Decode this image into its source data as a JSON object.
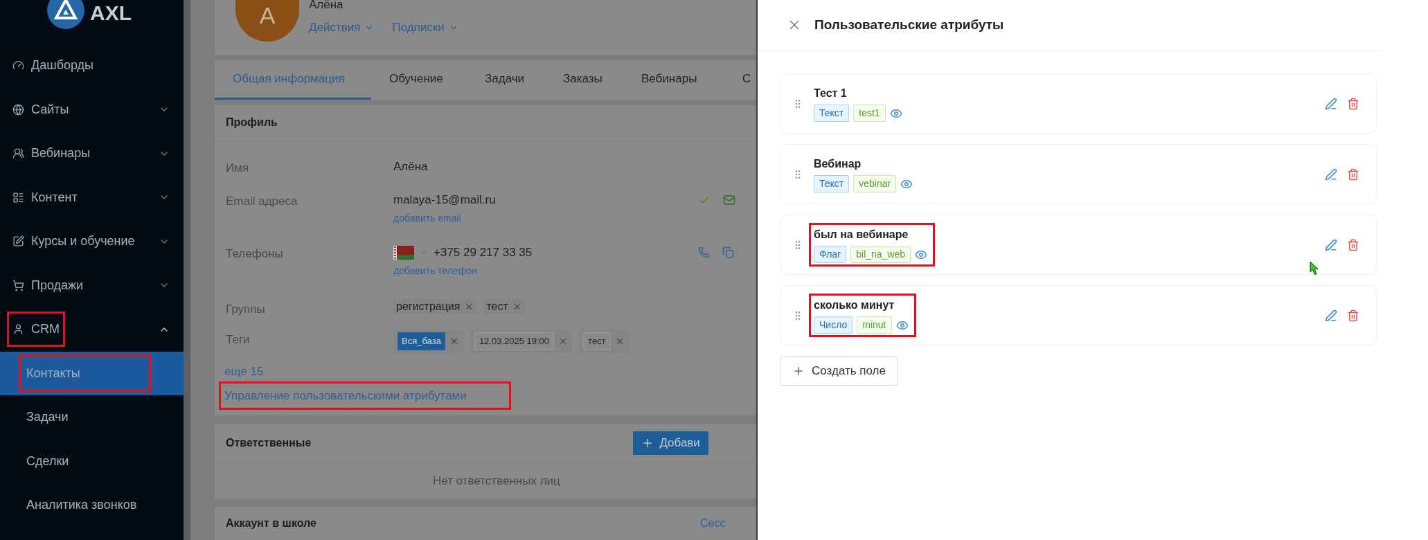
{
  "sidebar": {
    "logo": {
      "text": "AXL"
    },
    "items": [
      {
        "label": "Дашборды",
        "selected": false,
        "annotated": false
      },
      {
        "label": "Сайты",
        "expanded": false,
        "selected": false,
        "annotated": false
      },
      {
        "label": "Вебинары",
        "expanded": false,
        "selected": false,
        "annotated": false
      },
      {
        "label": "Контент",
        "expanded": false,
        "selected": false,
        "annotated": false
      },
      {
        "label": "Курсы и обучение",
        "expanded": false,
        "selected": false,
        "annotated": false
      },
      {
        "label": "Продажи",
        "expanded": false,
        "selected": false,
        "annotated": false
      },
      {
        "label": "CRM",
        "expanded": true,
        "selected": false,
        "annotated": true,
        "children": [
          {
            "label": "Контакты",
            "selected": true,
            "annotated": true
          },
          {
            "label": "Задачи",
            "selected": false,
            "annotated": false
          },
          {
            "label": "Сделки",
            "selected": false,
            "annotated": false
          },
          {
            "label": "Аналитика звонков",
            "selected": false,
            "annotated": false
          }
        ]
      }
    ]
  },
  "contact": {
    "name": "Алёна",
    "avatar_letter": "A",
    "menus": [
      "Действия",
      "Подписки"
    ]
  },
  "tabs": [
    {
      "label": "Общая информация",
      "selected": true
    },
    {
      "label": "Обучение",
      "selected": false
    },
    {
      "label": "Задачи",
      "selected": false
    },
    {
      "label": "Заказы",
      "selected": false
    },
    {
      "label": "Вебинары",
      "selected": false
    },
    {
      "label": "С",
      "selected": false
    }
  ],
  "profile": {
    "title": "Профиль",
    "rows": [
      {
        "kind": "text",
        "label": "Имя",
        "value": "Алёна"
      },
      {
        "kind": "email",
        "label": "Email адреса",
        "value": "malaya-15@mail.ru",
        "add_link": "добавить email"
      },
      {
        "kind": "phone",
        "label": "Телефоны",
        "value": "+375 29 217 33 35",
        "add_link": "добавить телефон"
      },
      {
        "kind": "chips",
        "label": "Группы",
        "chips": [
          {
            "text": "регистрация",
            "highlighted": false
          },
          {
            "text": "тест",
            "highlighted": false
          }
        ]
      },
      {
        "kind": "tags",
        "label": "Теги",
        "chips": [
          {
            "text": "Вся_база",
            "highlighted": true
          },
          {
            "text": "12.03.2025 19:00",
            "highlighted": false
          },
          {
            "text": "тест",
            "highlighted": false
          }
        ]
      }
    ],
    "more_link": "еще 15",
    "manage_link": {
      "text": "Управление пользовательскими атрибутами",
      "annotated": true
    }
  },
  "responsible": {
    "title": "Ответственные",
    "add_button": "Добави",
    "empty_text": "Нет ответственных лиц"
  },
  "account": {
    "title": "Аккаунт в школе",
    "link": "Сесс"
  },
  "drawer": {
    "title": "Пользовательские атрибуты",
    "attributes": [
      {
        "name": "Тест 1",
        "type_label": "Текст",
        "code": "test1",
        "annotated": false
      },
      {
        "name": "Вебинар",
        "type_label": "Текст",
        "code": "vebinar",
        "annotated": false
      },
      {
        "name": "был на вебинаре",
        "type_label": "Флаг",
        "code": "bil_na_web",
        "annotated": true
      },
      {
        "name": "сколько минут",
        "type_label": "Число",
        "code": "minut",
        "annotated": true
      }
    ],
    "create_button": "Создать поле"
  }
}
